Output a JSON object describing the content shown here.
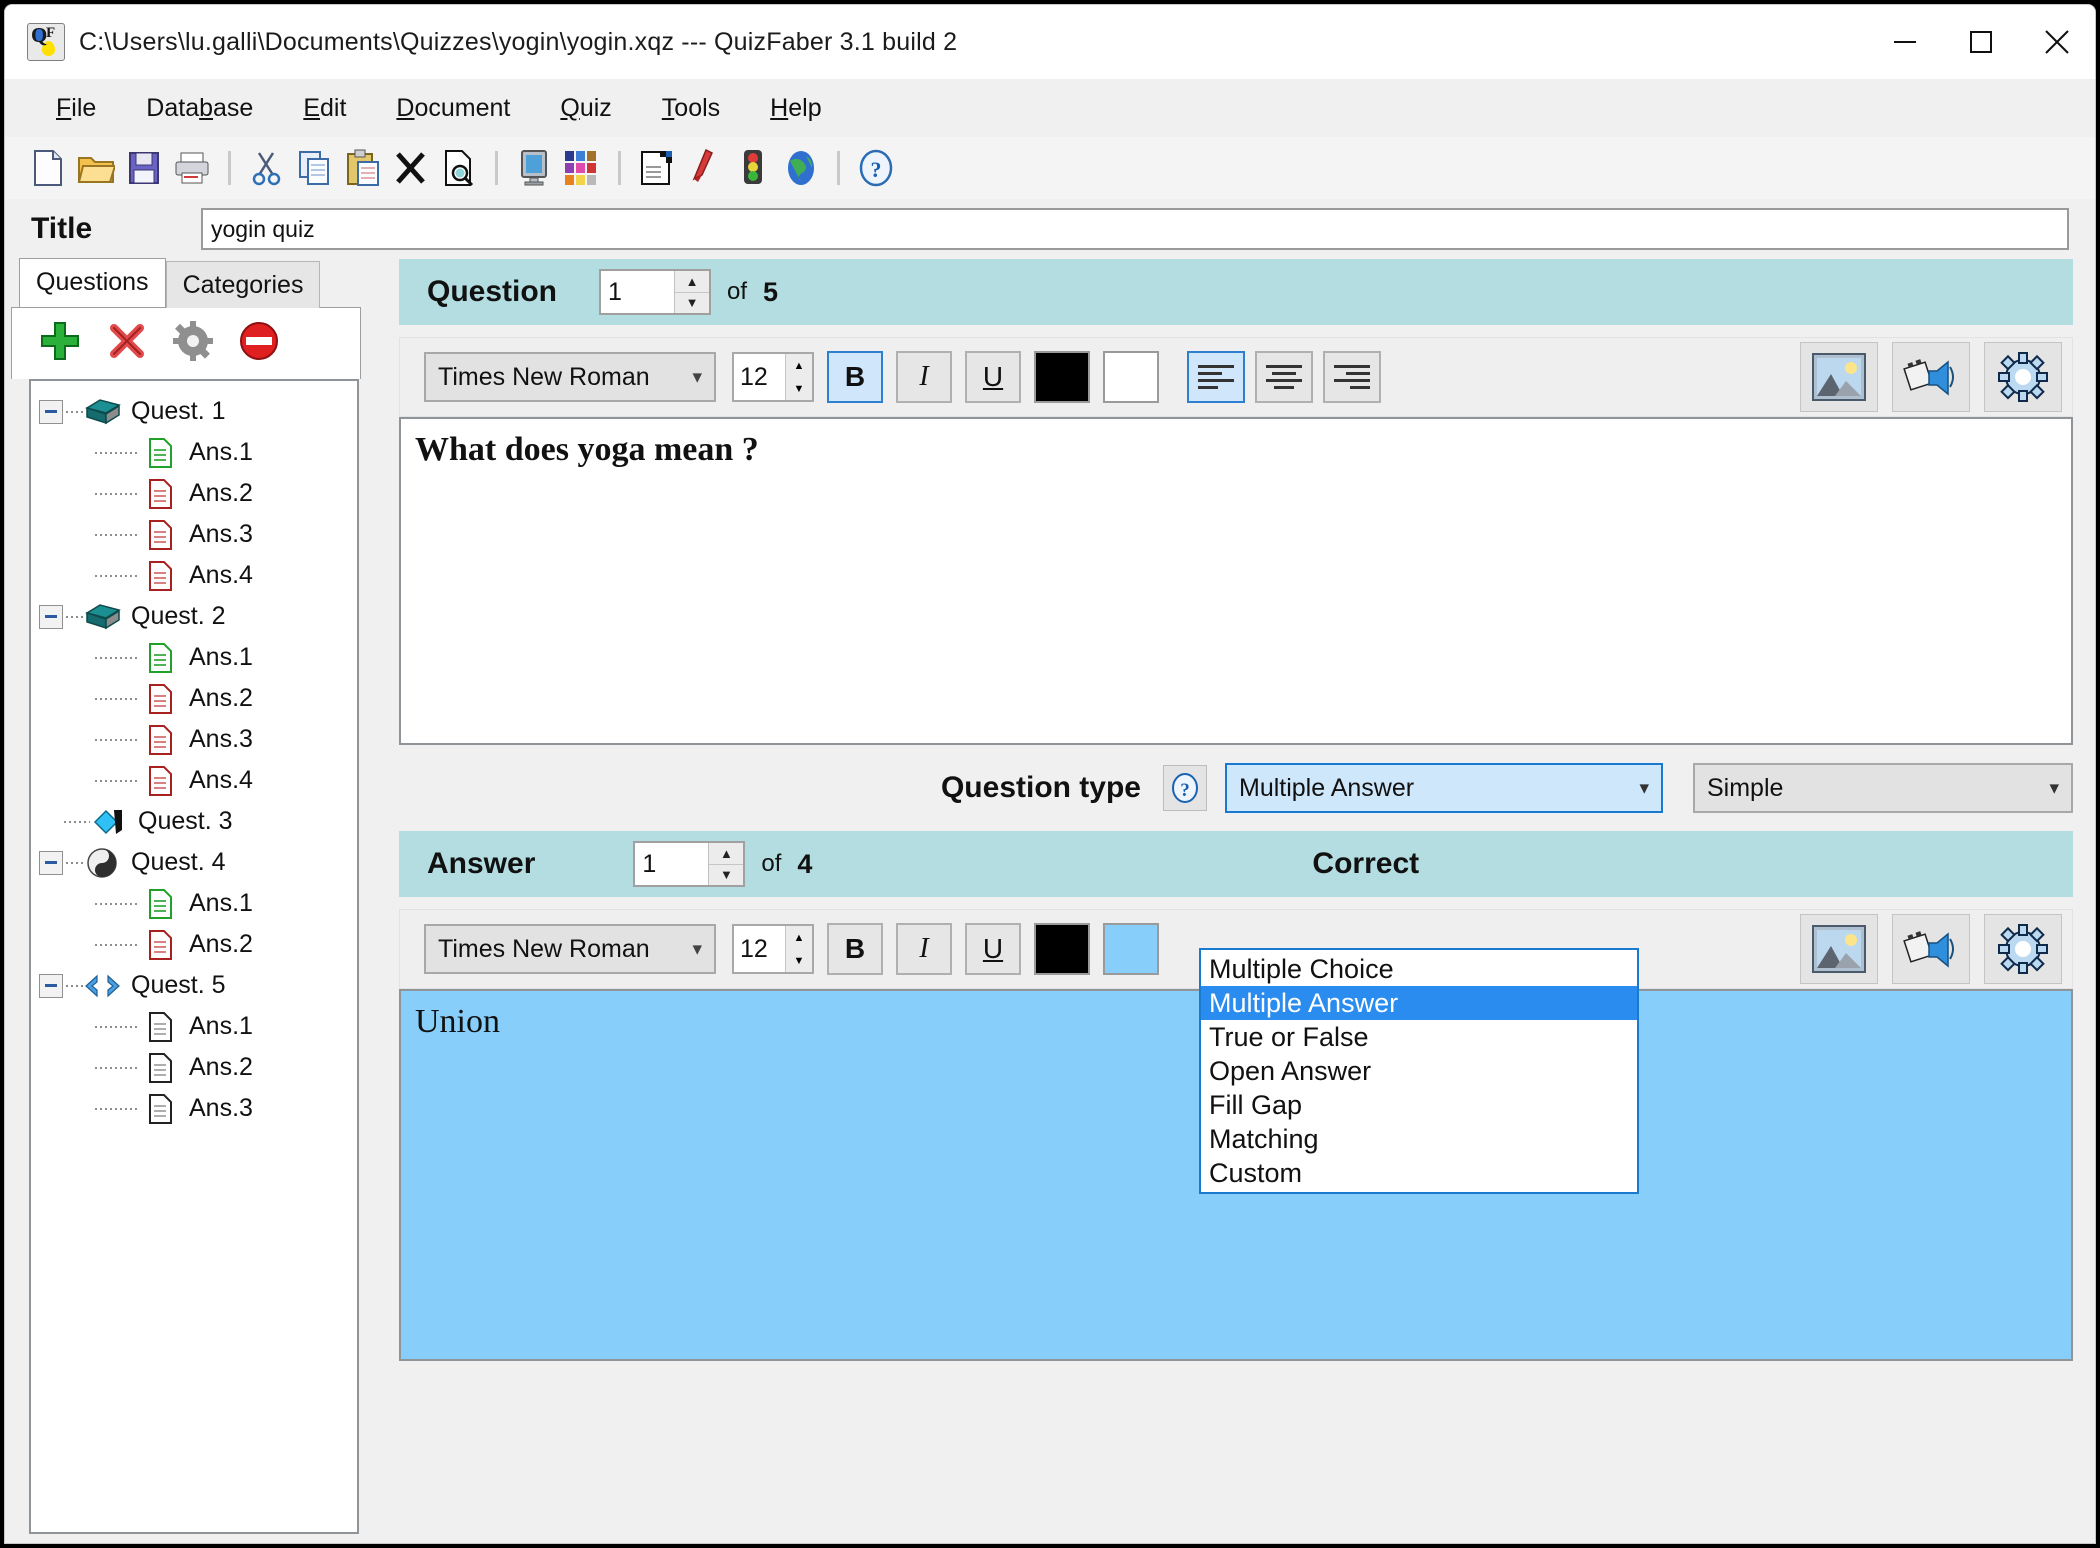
{
  "window": {
    "title": "C:\\Users\\lu.galli\\Documents\\Quizzes\\yogin\\yogin.xqz  ---  QuizFaber 3.1 build 2",
    "icon": "quizfaber-app-icon",
    "controls": {
      "minimize": "minimize-icon",
      "maximize": "maximize-icon",
      "close": "close-icon"
    }
  },
  "menu": [
    {
      "label": "File",
      "accel": "F"
    },
    {
      "label": "Database",
      "accel": "b"
    },
    {
      "label": "Edit",
      "accel": "E"
    },
    {
      "label": "Document",
      "accel": "D"
    },
    {
      "label": "Quiz",
      "accel": "Q"
    },
    {
      "label": "Tools",
      "accel": "T"
    },
    {
      "label": "Help",
      "accel": "H"
    }
  ],
  "toolbar": [
    {
      "name": "new-document-icon"
    },
    {
      "name": "open-folder-icon"
    },
    {
      "name": "save-icon"
    },
    {
      "name": "print-icon"
    },
    {
      "sep": true
    },
    {
      "name": "cut-icon"
    },
    {
      "name": "copy-icon"
    },
    {
      "name": "paste-icon"
    },
    {
      "name": "delete-icon"
    },
    {
      "name": "preview-icon"
    },
    {
      "sep": true
    },
    {
      "name": "monitor-icon"
    },
    {
      "name": "color-palette-icon"
    },
    {
      "sep": true
    },
    {
      "name": "properties-icon"
    },
    {
      "name": "check-pen-icon"
    },
    {
      "name": "traffic-light-icon"
    },
    {
      "name": "globe-icon"
    },
    {
      "sep": true
    },
    {
      "name": "help-icon"
    }
  ],
  "title_field": {
    "label": "Title",
    "value": "yogin quiz"
  },
  "sidebar": {
    "tabs": [
      {
        "label": "Questions",
        "active": true
      },
      {
        "label": "Categories",
        "active": false
      }
    ],
    "tools": [
      {
        "name": "add-icon"
      },
      {
        "name": "delete-icon"
      },
      {
        "name": "settings-gear-icon"
      },
      {
        "name": "no-entry-icon"
      }
    ],
    "tree": [
      {
        "label": "Quest. 1",
        "icon": "book-teal-icon",
        "expanded": true,
        "children": [
          {
            "label": "Ans.1",
            "icon": "doc-green-icon"
          },
          {
            "label": "Ans.2",
            "icon": "doc-red-icon"
          },
          {
            "label": "Ans.3",
            "icon": "doc-red-icon"
          },
          {
            "label": "Ans.4",
            "icon": "doc-red-icon"
          }
        ]
      },
      {
        "label": "Quest. 2",
        "icon": "book-teal-icon",
        "expanded": true,
        "children": [
          {
            "label": "Ans.1",
            "icon": "doc-green-icon"
          },
          {
            "label": "Ans.2",
            "icon": "doc-red-icon"
          },
          {
            "label": "Ans.3",
            "icon": "doc-red-icon"
          },
          {
            "label": "Ans.4",
            "icon": "doc-red-icon"
          }
        ]
      },
      {
        "label": "Quest. 3",
        "icon": "diamond-cyan-icon",
        "expanded": false,
        "children": []
      },
      {
        "label": "Quest. 4",
        "icon": "yin-yang-icon",
        "expanded": true,
        "children": [
          {
            "label": "Ans.1",
            "icon": "doc-green-icon"
          },
          {
            "label": "Ans.2",
            "icon": "doc-red-icon"
          }
        ]
      },
      {
        "label": "Quest. 5",
        "icon": "matching-arrows-icon",
        "expanded": true,
        "children": [
          {
            "label": "Ans.1",
            "icon": "doc-gray-icon"
          },
          {
            "label": "Ans.2",
            "icon": "doc-gray-icon"
          },
          {
            "label": "Ans.3",
            "icon": "doc-gray-icon"
          }
        ]
      }
    ]
  },
  "question_panel": {
    "label": "Question",
    "index": "1",
    "of": "of",
    "total": "5",
    "format": {
      "font": "Times New Roman",
      "size": "12",
      "bold_label": "B",
      "italic_label": "I",
      "underline_label": "U",
      "bold_active": true,
      "fg_color": "#000000",
      "bg_color": "#ffffff",
      "align": "left"
    },
    "media_buttons": [
      {
        "name": "insert-image-icon"
      },
      {
        "name": "insert-media-icon"
      },
      {
        "name": "question-settings-gear-icon"
      }
    ],
    "text": "What does yoga mean ?"
  },
  "question_type": {
    "label": "Question type",
    "help_icon": "help-circle-icon",
    "selected": "Multiple Answer",
    "options": [
      "Multiple Choice",
      "Multiple Answer",
      "True or False",
      "Open Answer",
      "Fill Gap",
      "Matching",
      "Custom"
    ],
    "open": true,
    "mode_selected": "Simple",
    "highlight_color": "#2b8cf0"
  },
  "answer_panel": {
    "label": "Answer",
    "index": "1",
    "of": "of",
    "total": "4",
    "correct_label": "Correct",
    "format": {
      "font": "Times New Roman",
      "size": "12",
      "bold_label": "B",
      "italic_label": "I",
      "underline_label": "U",
      "bold_active": false,
      "fg_color": "#000000",
      "bg_color": "#87cefa"
    },
    "media_buttons": [
      {
        "name": "insert-image-icon"
      },
      {
        "name": "insert-media-icon"
      },
      {
        "name": "answer-settings-gear-icon"
      }
    ],
    "text": "Union",
    "text_background": "#87cefa"
  },
  "colors": {
    "band_header": "#b3dde0",
    "accent_blue": "#2b8cf0",
    "answer_blue": "#87cefa"
  }
}
